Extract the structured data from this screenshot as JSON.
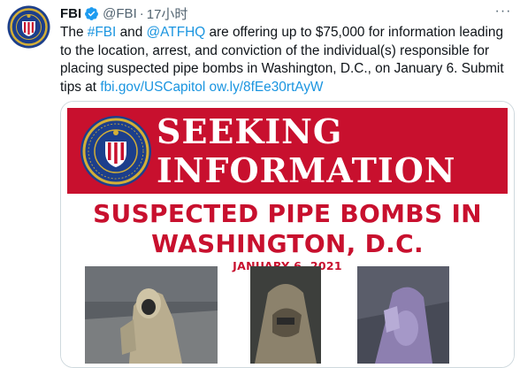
{
  "tweet": {
    "author_name": "FBI",
    "handle": "@FBI",
    "separator": "·",
    "time": "17小时",
    "more": "···",
    "text": {
      "p1": "The ",
      "hashtag": "#FBI",
      "p2": " and ",
      "mention": "@ATFHQ",
      "p3": " are offering up to $75,000 for information leading to the location, arrest, and conviction of the individual(s) responsible for placing suspected pipe bombs in Washington, D.C., on January 6. Submit tips at ",
      "link1": "fbi.gov/USCapitol",
      "p4": " ",
      "link2": "ow.ly/8fEe30rtAyW"
    }
  },
  "poster": {
    "seeking_line1": "SEEKING",
    "seeking_line2": "INFORMATION",
    "headline_line1": "SUSPECTED PIPE BOMBS IN",
    "headline_line2": "WASHINGTON, D.C.",
    "date": "JANUARY 6, 2021"
  },
  "icons": {
    "avatar": "fbi-seal-avatar",
    "verified": "verified-badge-icon",
    "more": "more-icon"
  },
  "colors": {
    "link": "#1b95e0",
    "poster_red": "#c8102e",
    "verified": "#1d9bf0"
  }
}
